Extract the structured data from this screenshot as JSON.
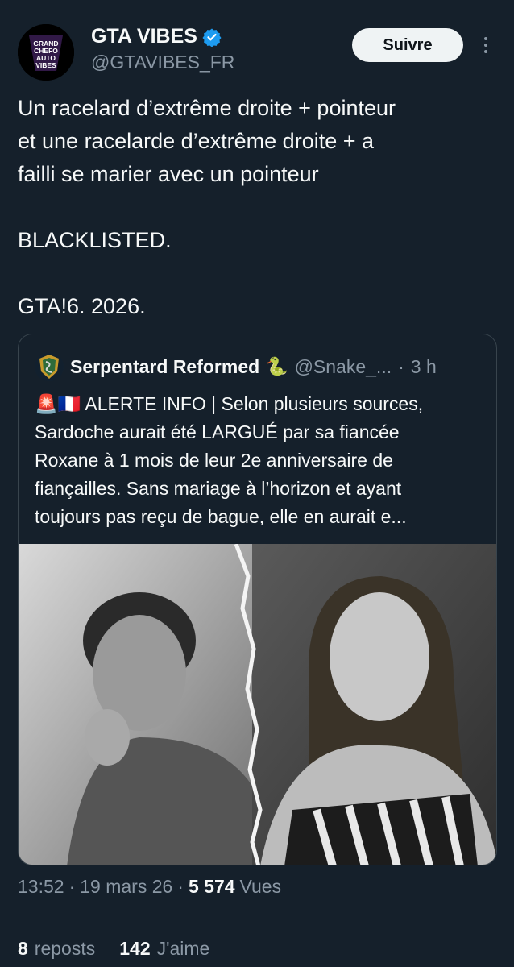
{
  "author": {
    "display_name": "GTA VIBES",
    "handle": "@GTAVIBES_FR",
    "avatar_text": "GRAND CHEFO AUTO VIBES",
    "verified_color": "#1d9bf0"
  },
  "follow_label": "Suivre",
  "tweet": {
    "lines": [
      "Un racelard d’extrême droite + pointeur",
      "et une racelarde d’extrême droite + a",
      "failli se marier avec un pointeur"
    ],
    "line2": "BLACKLISTED.",
    "line3": "GTA!6. 2026."
  },
  "quote": {
    "name": "Serpentard Reformed",
    "emoji": "🐍",
    "handle": "@Snake_...",
    "dot": "·",
    "time": "3 h",
    "text_lines": [
      "🚨🇫🇷 ALERTE INFO | Selon plusieurs sources,",
      "Sardoche aurait été LARGUÉ par sa fiancée",
      "Roxane à 1 mois de leur 2e anniversaire de",
      "fiançailles. Sans mariage à l’horizon et ayant",
      "toujours pas reçu de bague, elle en aurait e..."
    ]
  },
  "meta": {
    "time": "13:52",
    "sep1": "·",
    "date": "19 mars 26",
    "sep2": "·",
    "views_count": "5 574",
    "views_label": "Vues"
  },
  "stats": {
    "reposts_count": "8",
    "reposts_label": "reposts",
    "likes_count": "142",
    "likes_label": "J'aime"
  },
  "colors": {
    "background": "#15202b",
    "text": "#f7f9f9",
    "secondary": "#8b98a5",
    "border": "#38444d"
  }
}
